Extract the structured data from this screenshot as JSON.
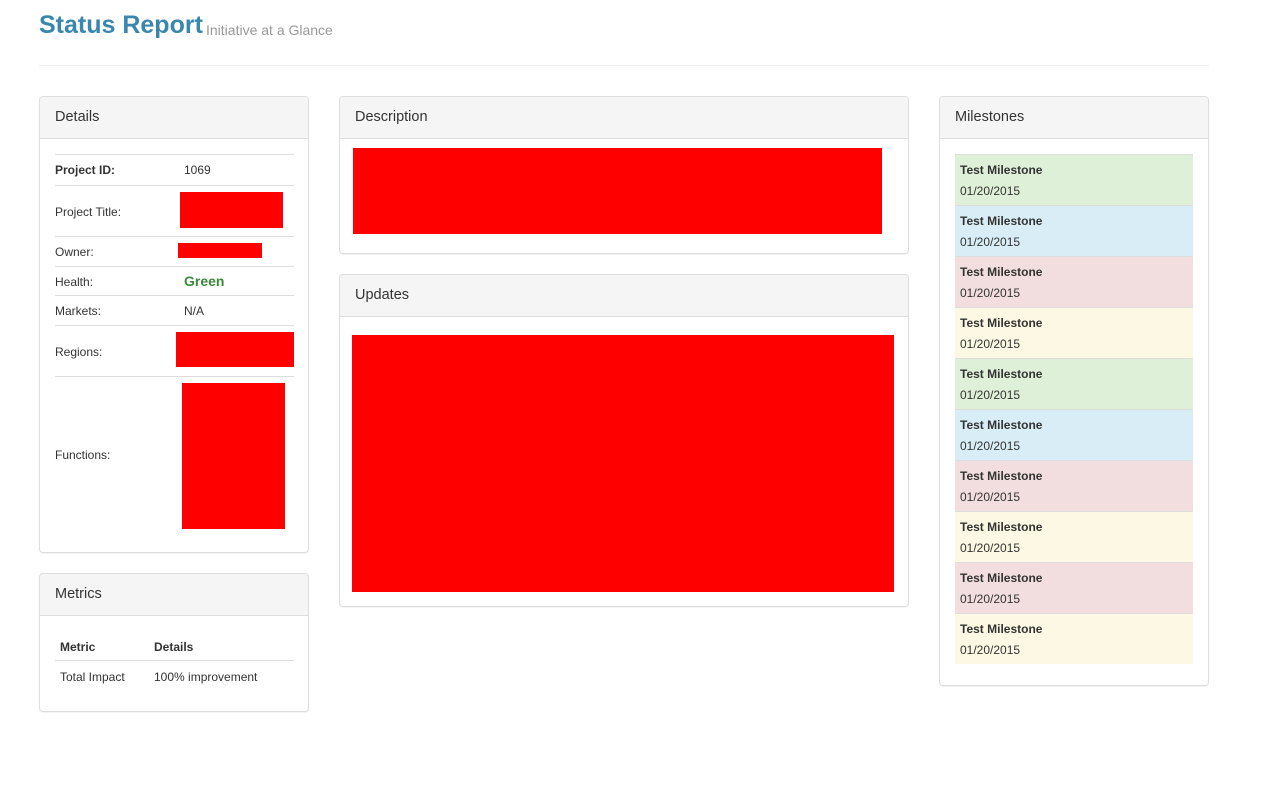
{
  "header": {
    "title": "Status Report",
    "subtitle": "Initiative at a Glance"
  },
  "details": {
    "heading": "Details",
    "project_id_label": "Project ID:",
    "project_id_value": "1069",
    "project_title_label": "Project Title:",
    "owner_label": "Owner:",
    "health_label": "Health:",
    "health_value": "Green",
    "markets_label": "Markets:",
    "markets_value": "N/A",
    "regions_label": "Regions:",
    "functions_label": "Functions:"
  },
  "metrics": {
    "heading": "Metrics",
    "columns": [
      "Metric",
      "Details"
    ],
    "rows": [
      {
        "metric": "Total Impact",
        "details": "100% improvement"
      }
    ]
  },
  "description": {
    "heading": "Description"
  },
  "updates": {
    "heading": "Updates"
  },
  "milestones": {
    "heading": "Milestones",
    "items": [
      {
        "title": "Test Milestone",
        "date": "01/20/2015",
        "status": "success"
      },
      {
        "title": "Test Milestone",
        "date": "01/20/2015",
        "status": "info"
      },
      {
        "title": "Test Milestone",
        "date": "01/20/2015",
        "status": "danger"
      },
      {
        "title": "Test Milestone",
        "date": "01/20/2015",
        "status": "warning"
      },
      {
        "title": "Test Milestone",
        "date": "01/20/2015",
        "status": "success"
      },
      {
        "title": "Test Milestone",
        "date": "01/20/2015",
        "status": "info"
      },
      {
        "title": "Test Milestone",
        "date": "01/20/2015",
        "status": "danger"
      },
      {
        "title": "Test Milestone",
        "date": "01/20/2015",
        "status": "warning"
      },
      {
        "title": "Test Milestone",
        "date": "01/20/2015",
        "status": "danger"
      },
      {
        "title": "Test Milestone",
        "date": "01/20/2015",
        "status": "warning"
      }
    ]
  },
  "colors": {
    "title": "#3a87ad",
    "health_green": "#3c8a3c",
    "redaction": "#ff0000",
    "success": "#dff0d8",
    "info": "#d9edf7",
    "danger": "#f2dede",
    "warning": "#fcf8e3"
  }
}
